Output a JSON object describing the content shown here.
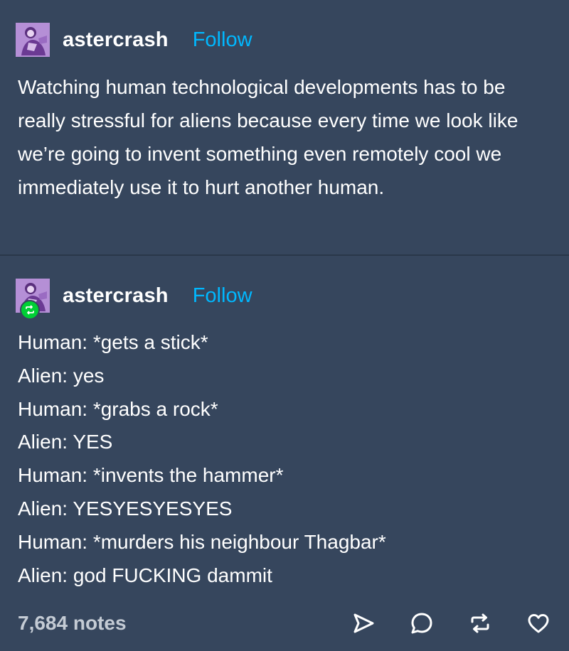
{
  "post": {
    "author": "astercrash",
    "follow_label": "Follow",
    "body": "Watching human technological developments has to be really stressful for aliens because every time we look like we’re going to invent something even remotely cool we immediately use it to hurt another human."
  },
  "reblog": {
    "author": "astercrash",
    "follow_label": "Follow",
    "lines": [
      "Human: *gets a stick*",
      "Alien: yes",
      "Human: *grabs a rock*",
      "Alien: YES",
      "Human: *invents the hammer*",
      "Alien: YESYESYESYES",
      "Human: *murders his neighbour Thagbar*",
      "Alien: god FUCKING dammit"
    ]
  },
  "footer": {
    "notes": "7,684 notes",
    "icons": [
      "share-icon",
      "reply-icon",
      "reblog-icon",
      "like-icon"
    ]
  },
  "colors": {
    "background": "#36465d",
    "follow": "#00b8ff",
    "reblog_badge": "#00cf35",
    "notes_text": "#c4cbd4"
  }
}
